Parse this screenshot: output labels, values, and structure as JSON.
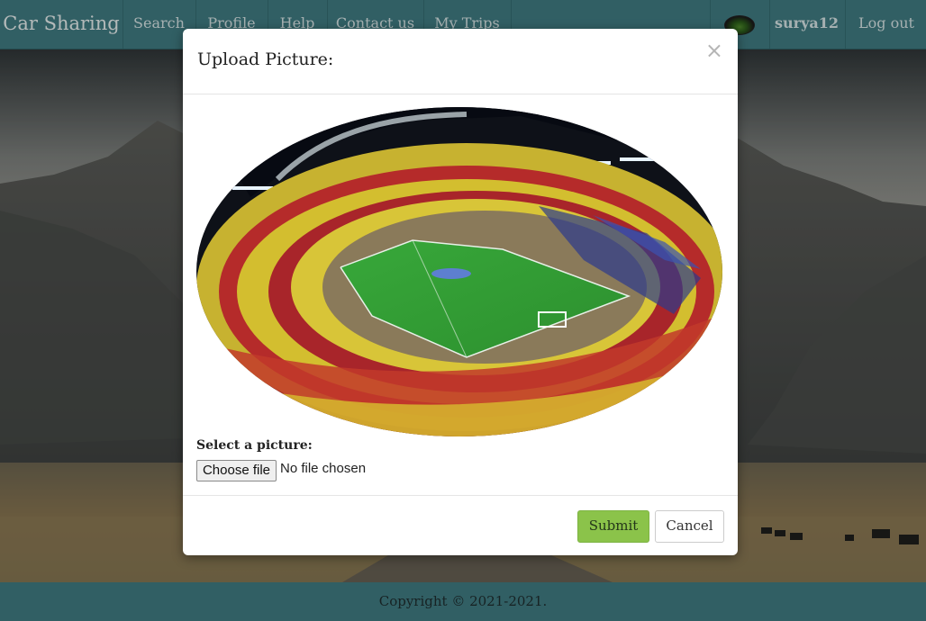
{
  "navbar": {
    "brand": "Car Sharing",
    "items": [
      {
        "label": "Search"
      },
      {
        "label": "Profile"
      },
      {
        "label": "Help"
      },
      {
        "label": "Contact us"
      },
      {
        "label": "My Trips"
      }
    ],
    "username": "surya12",
    "logout_label": "Log out",
    "active_item": "Profile",
    "bar_color": "#3f7a80"
  },
  "modal": {
    "title": "Upload Picture:",
    "close_icon": "close-icon",
    "image_subject": "stadium-photo",
    "select_label": "Select a picture:",
    "choose_file_label": "Choose file",
    "file_status": "No file chosen",
    "submit_label": "Submit",
    "cancel_label": "Cancel",
    "submit_color": "#8bc34a"
  },
  "footer": {
    "copyright": "Copyright © 2021-2021."
  }
}
